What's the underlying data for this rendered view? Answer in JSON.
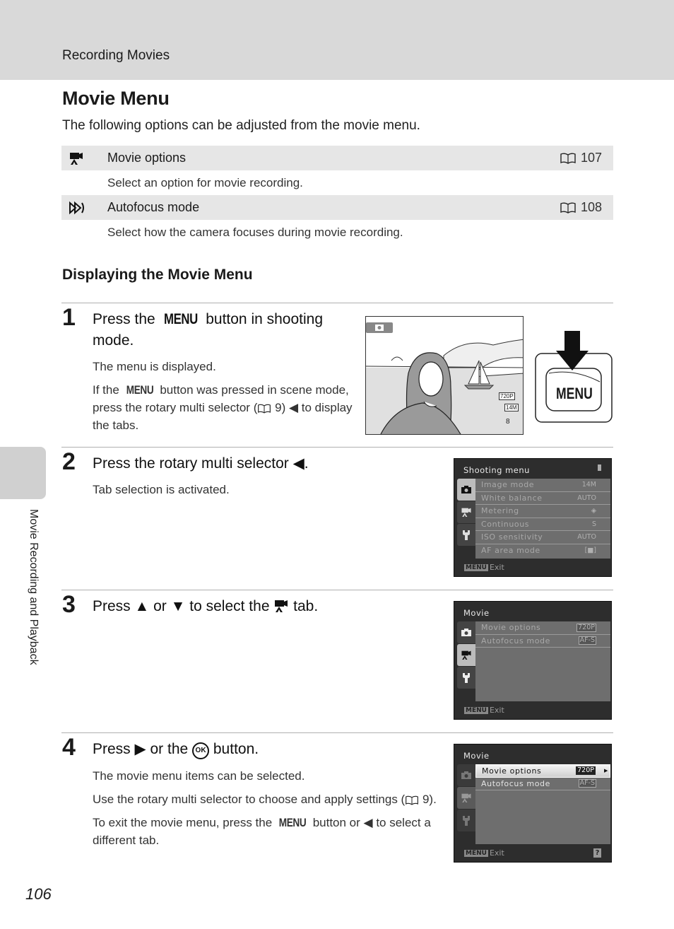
{
  "header": {
    "section_label": "Recording Movies"
  },
  "page": {
    "title": "Movie Menu",
    "intro": "The following options can be adjusted from the movie menu.",
    "page_number": "106",
    "side_tab_label": "Movie Recording and Playback"
  },
  "options": [
    {
      "icon": "movie-camera-icon",
      "label": "Movie options",
      "ref": "107",
      "description": "Select an option for movie recording."
    },
    {
      "icon": "autofocus-mode-icon",
      "label": "Autofocus mode",
      "ref": "108",
      "description": "Select how the camera focuses during movie recording."
    }
  ],
  "subsection": {
    "title": "Displaying the Movie Menu"
  },
  "steps": [
    {
      "number": "1",
      "title_pre": "Press the ",
      "title_menu": "MENU",
      "title_post": " button in shooting mode.",
      "body": [
        "The menu is displayed."
      ],
      "body2_pre": "If the ",
      "body2_menu": "MENU",
      "body2_mid": " button was pressed in scene mode, press the rotary multi selector (",
      "body2_ref": "9",
      "body2_post": ") ◀ to display the tabs."
    },
    {
      "number": "2",
      "title": "Press the rotary multi selector ◀.",
      "body": "Tab selection is activated."
    },
    {
      "number": "3",
      "title_pre": "Press ▲ or ▼ to select the ",
      "title_post": " tab."
    },
    {
      "number": "4",
      "title_pre": "Press ▶ or the ",
      "title_ok": "OK",
      "title_post": " button.",
      "body1": "The movie menu items can be selected.",
      "body2_pre": "Use the rotary multi selector to choose and apply settings (",
      "body2_ref": "9",
      "body2_post": ").",
      "body3_pre": "To exit the movie menu, press the ",
      "body3_menu": "MENU",
      "body3_post": " button or ◀ to select a different tab."
    }
  ],
  "illustrations": {
    "lcd_readouts": {
      "movie_size": "720P",
      "image_mode": "14M",
      "shots_remaining": "8"
    },
    "menu_button_label": "MENU"
  },
  "screens": {
    "shooting_menu": {
      "title": "Shooting menu",
      "items": [
        {
          "label": "Image mode",
          "value": "14M"
        },
        {
          "label": "White balance",
          "value": "AUTO"
        },
        {
          "label": "Metering",
          "value": "◈"
        },
        {
          "label": "Continuous",
          "value": "S"
        },
        {
          "label": "ISO sensitivity",
          "value": "AUTO"
        },
        {
          "label": "AF area mode",
          "value": "[■]"
        }
      ],
      "footer_chip": "MENU",
      "footer_text": "Exit"
    },
    "movie_menu_tab": {
      "title": "Movie",
      "items": [
        {
          "label": "Movie options",
          "value": "720P"
        },
        {
          "label": "Autofocus mode",
          "value": "AF-S"
        }
      ],
      "footer_chip": "MENU",
      "footer_text": "Exit"
    },
    "movie_menu_items": {
      "title": "Movie",
      "items": [
        {
          "label": "Movie options",
          "value": "720P"
        },
        {
          "label": "Autofocus mode",
          "value": "AF-S"
        }
      ],
      "footer_chip": "MENU",
      "footer_text": "Exit",
      "help": "?"
    }
  }
}
